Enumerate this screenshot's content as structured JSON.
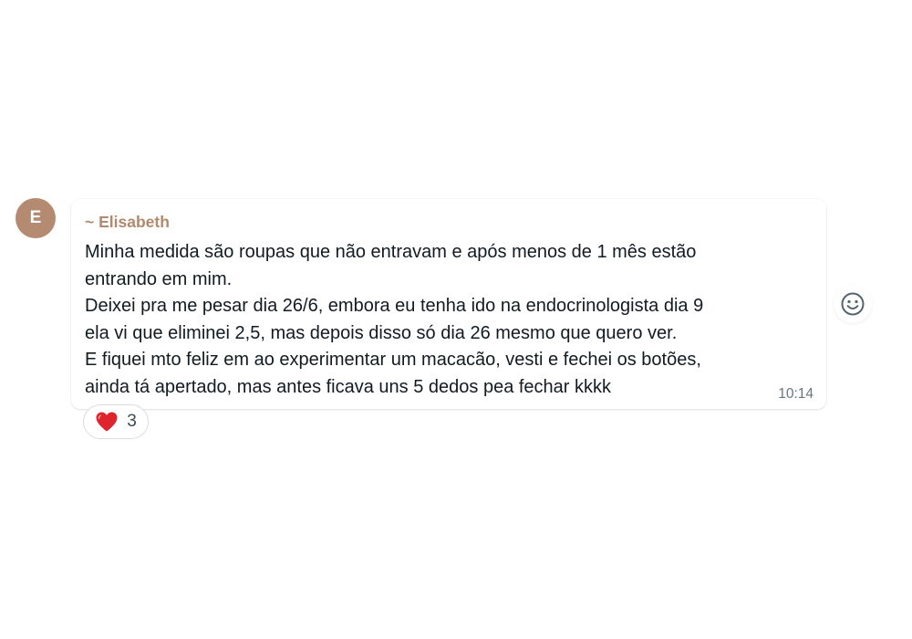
{
  "sender": {
    "avatar_initial": "E",
    "avatar_color": "#b48b70",
    "name": "~ Elisabeth",
    "name_color": "#b08a6e"
  },
  "message": {
    "lines": [
      "Minha medida são roupas que não entravam e após menos de 1 mês estão",
      "entrando em mim.",
      "Deixei pra me pesar dia 26/6, embora eu tenha ido na endocrinologista dia 9",
      "ela vi que eliminei 2,5, mas depois disso só dia 26 mesmo que quero ver.",
      "E fiquei mto feliz em ao experimentar um macacão, vesti e fechei os botões,",
      "ainda tá apertado, mas antes ficava uns 5 dedos pea fechar kkkk"
    ],
    "time": "10:14"
  },
  "reaction": {
    "icon": "red-heart-icon",
    "color": "#e0242e",
    "count": "3"
  },
  "actions": {
    "emoji_button_icon": "smiley-face-icon"
  }
}
